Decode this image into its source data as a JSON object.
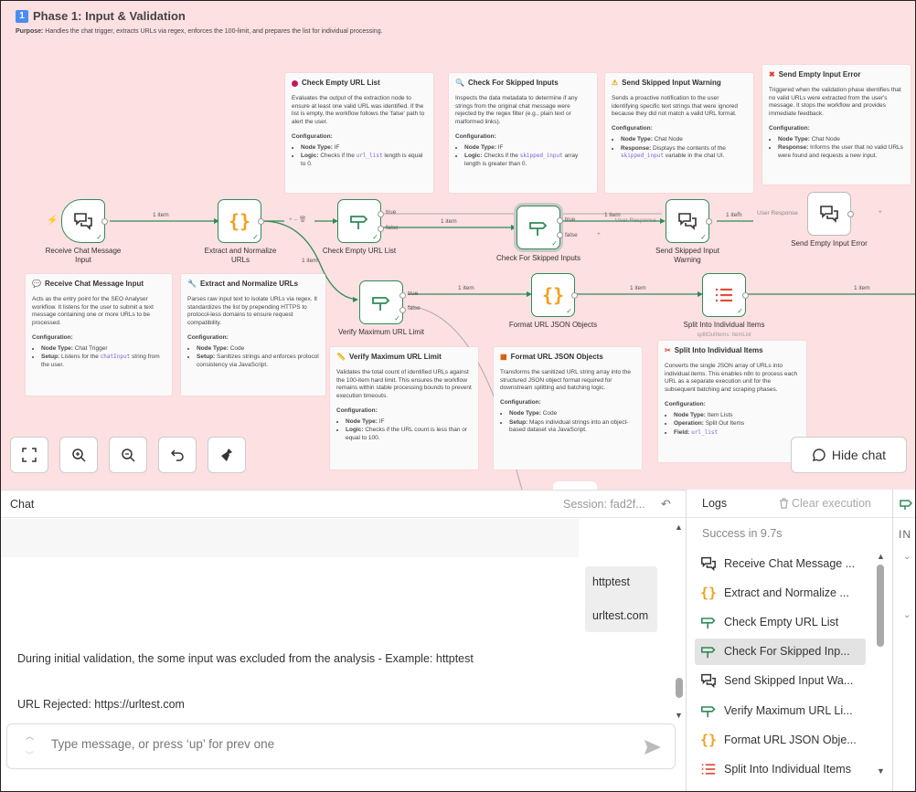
{
  "phase": {
    "badge": "1",
    "title": "Phase 1: Input & Validation",
    "purpose_label": "Purpose:",
    "purpose_text": "Handles the chat trigger, extracts URLs via regex, enforces the 100-limit, and prepares the list for individual processing."
  },
  "notes": {
    "check_empty": {
      "title": "Check Empty URL List",
      "body": "Evaluates the output of the extraction node to ensure at least one valid URL was identified. If the list is empty, the workflow follows the 'false' path to alert the user.",
      "config_label": "Configuration:",
      "item1_key": "Node Type:",
      "item1_val": "IF",
      "item2_key": "Logic:",
      "item2_pre": "Checks if the",
      "item2_code": "url_list",
      "item2_post": "length is equal to 0."
    },
    "check_skipped": {
      "title": "Check For Skipped Inputs",
      "body": "Inspects the data metadata to determine if any strings from the original chat message were rejected by the regex filter (e.g., plain text or malformed links).",
      "config_label": "Configuration:",
      "item1_key": "Node Type:",
      "item1_val": "IF",
      "item2_key": "Logic:",
      "item2_pre": "Checks if the",
      "item2_code": "skipped_input",
      "item2_post": "array length is greater than 0."
    },
    "send_skipped": {
      "title": "Send Skipped Input Warning",
      "body": "Sends a proactive notification to the user identifying specific text strings that were ignored because they did not match a valid URL format.",
      "config_label": "Configuration:",
      "item1_key": "Node Type:",
      "item1_val": "Chat Node",
      "item2_key": "Response:",
      "item2_pre": "Displays the contents of the",
      "item2_code": "skipped_input",
      "item2_post": "variable in the chat UI."
    },
    "send_empty": {
      "title": "Send Empty Input Error",
      "body": "Triggered when the validation phase identifies that no valid URLs were extracted from the user's message. It stops the workflow and provides immediate feedback.",
      "config_label": "Configuration:",
      "item1_key": "Node Type:",
      "item1_val": "Chat Node",
      "item2_key": "Response:",
      "item2_pre": "Informs the user that no valid URLs were found and requests a new input.",
      "item2_code": "",
      "item2_post": ""
    },
    "receive": {
      "title": "Receive Chat Message Input",
      "body": "Acts as the entry point for the SEO Analyser workflow. It listens for the user to submit a text message containing one or more URLs to be processed.",
      "config_label": "Configuration:",
      "item1_key": "Node Type:",
      "item1_val": "Chat Trigger",
      "item2_key": "Setup:",
      "item2_pre": "Listens for the",
      "item2_code": "chatInput",
      "item2_post": "string from the user."
    },
    "extract": {
      "title": "Extract and Normalize URLs",
      "body": "Parses raw input text to isolate URLs via regex. It standardizes the list by prepending HTTPS to protocol-less domains to ensure request compatibility.",
      "config_label": "Configuration:",
      "item1_key": "Node Type:",
      "item1_val": "Code",
      "item2_key": "Setup:",
      "item2_pre": "Sanitizes strings and enforces protocol consistency via JavaScript.",
      "item2_code": "",
      "item2_post": ""
    },
    "verify_max": {
      "title": "Verify Maximum URL Limit",
      "body": "Validates the total count of identified URLs against the 100-item hard limit. This ensures the workflow remains within stable processing bounds to prevent execution timeouts.",
      "config_label": "Configuration:",
      "item1_key": "Node Type:",
      "item1_val": "IF",
      "item2_key": "Logic:",
      "item2_pre": "Checks if the URL count is less than or equal to 100.",
      "item2_code": "",
      "item2_post": ""
    },
    "format_json": {
      "title": "Format URL JSON Objects",
      "body": "Transforms the sanitized URL string array into the structured JSON object format required for downstream splitting and batching logic.",
      "config_label": "Configuration:",
      "item1_key": "Node Type:",
      "item1_val": "Code",
      "item2_key": "Setup:",
      "item2_pre": "Maps individual strings into an object-based dataset via JavaScript.",
      "item2_code": "",
      "item2_post": ""
    },
    "split": {
      "title": "Split Into Individual Items",
      "body": "Converts the single JSON array of URLs into individual items. This enables n8n to process each URL as a separate execution unit for the subsequent batching and scraping phases.",
      "config_label": "Configuration:",
      "item1_key": "Node Type:",
      "item1_val": "Item Lists",
      "item2_key": "Operation:",
      "item2_pre": "Split Out Items",
      "item2_code": "",
      "item3_key": "Field:",
      "item3_code": "url_list"
    }
  },
  "nodes": {
    "receive": "Receive Chat Message Input",
    "extract": "Extract and Normalize URLs",
    "check_empty": "Check Empty URL List",
    "check_skipped": "Check For Skipped Inputs",
    "send_skipped": "Send Skipped Input Warning",
    "send_empty": "Send Empty Input Error",
    "verify_max": "Verify Maximum URL Limit",
    "format_json": "Format URL JSON Objects",
    "split": "Split Into Individual Items",
    "split_sub": "splitOutItems: ItemList"
  },
  "edges": {
    "one_item": "1 item",
    "true": "true",
    "false": "false",
    "user_response": "User Response"
  },
  "canvas_controls": {
    "hide_chat": "Hide chat"
  },
  "chat": {
    "title": "Chat",
    "session": "Session: fad2f...",
    "user_line1": "httptest",
    "user_line2": "urltest.com",
    "bot_line1": "During initial validation, the some input was excluded from the analysis - Example: httptest",
    "bot_line2": "URL Rejected: https://urltest.com",
    "input_placeholder": "Type message, or press ‘up’ for prev one"
  },
  "logs": {
    "title": "Logs",
    "clear": "Clear execution",
    "status": "Success in 9.7s",
    "items": [
      {
        "label": "Receive Chat Message ...",
        "icon": "chat-icon"
      },
      {
        "label": "Extract and Normalize ...",
        "icon": "code-icon"
      },
      {
        "label": "Check Empty URL List",
        "icon": "if-icon"
      },
      {
        "label": "Check For Skipped Inp...",
        "icon": "if-icon"
      },
      {
        "label": "Send Skipped Input Wa...",
        "icon": "chat-icon"
      },
      {
        "label": "Verify Maximum URL Li...",
        "icon": "if-icon"
      },
      {
        "label": "Format URL JSON Obje...",
        "icon": "code-icon"
      },
      {
        "label": "Split Into Individual Items",
        "icon": "list-icon"
      }
    ]
  },
  "right_panel": {
    "label": "IN"
  },
  "colors": {
    "canvas": "#fde0e2",
    "node_border": "#2e8b57",
    "code_icon": "#f0a020",
    "split_icon": "#e74c3c"
  }
}
